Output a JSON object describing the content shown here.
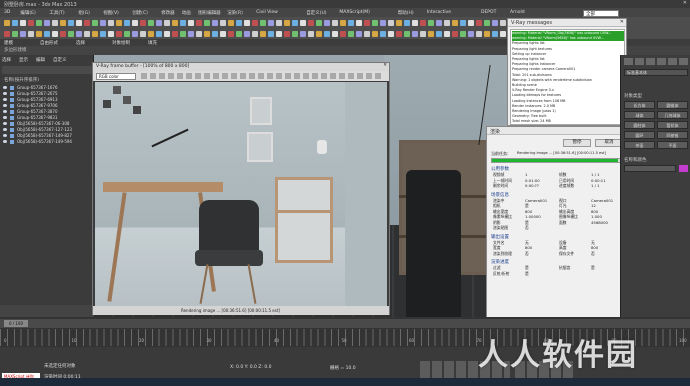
{
  "app": {
    "title": "别墅卧房.max - 3ds Max 2013"
  },
  "menu": [
    "3D",
    "编辑(E)",
    "工具(T)",
    "组(G)",
    "视图(V)",
    "创建(C)",
    "修改器",
    "动画",
    "图形编辑器",
    "渲染(R)",
    "Civil View",
    "自定义(U)",
    "MAXScript(M)",
    "帮助(H)",
    "Interactive",
    "DEPOT",
    "Arnold"
  ],
  "toolbar": {
    "selection_filter": "全部",
    "view_dropdown": "视图",
    "selection_set": "创建选择集"
  },
  "ribbon": {
    "tabs": [
      "建模",
      "自由形式",
      "选择",
      "对象绘制",
      "填充"
    ],
    "subtitle": "多边形建模"
  },
  "scene_explorer": {
    "tabs": [
      "选择",
      "显示",
      "编辑",
      "自定义"
    ],
    "header": "名称(按升序排序)",
    "items": [
      "Group-657367-1676",
      "Group-657367-2675",
      "Group-657367-6913",
      "Group-657367-9706",
      "Group-657367-3870",
      "Group-657367-9831",
      "Obj(5658)-657367-06-308",
      "Obj(5658)-657367-127-123",
      "Obj(5658)-657367-149-827",
      "Obj(5658)-657367-149-594"
    ]
  },
  "vfb": {
    "title": "V-Ray frame buffer - [100% of 800 x 800]",
    "channel": "RGB color",
    "status": "Rendering image ... [00:36:51.6] [00:00:11.5 est]"
  },
  "vray_messages": {
    "title": "V-Ray messages",
    "lines": [
      "warning: Material \"VNorm_Obj(5658)\" has unbound UVW...",
      "warning: Material \"VNorm(5658)\" has unbound UVW...",
      "Preparing lights list",
      "Preparing light textures",
      "Setting up instancer",
      "Preparing lights list",
      "Preparing lights instancer",
      "Preparing render camera Camera001",
      "Total: 201 sub-divisions",
      "Warning: 1 objects with rendertime subdivision",
      "Building scene",
      "V-Ray Render Engine 3.x",
      "Loading bitmaps for textures",
      "Loading instances from 108 MB",
      "Render instances: 2.0 MB",
      "Rendering image (pass 1)",
      "Geometry: Tree built",
      "Total mesh size: 24 MB"
    ]
  },
  "render_progress": {
    "title": "渲染",
    "btn_pause": "暂停",
    "btn_cancel": "取消",
    "current_task_label": "当前任务:",
    "current_task": "Rendering image ... [00:36:51.6] [00:00:11.5 est]",
    "progress": 0.97,
    "group_params": "公用参数",
    "p": [
      [
        "视频帧",
        "1"
      ],
      [
        "帧数",
        "1 / 1"
      ],
      [
        "上一帧时间",
        "0:01:00"
      ],
      [
        "已用时间",
        "0:00:11"
      ],
      [
        "剩余时间",
        "0:00:??"
      ],
      [
        "进度帧数",
        "1 / 1"
      ]
    ],
    "group_scene": "场景信息",
    "s": [
      [
        "渲染中",
        "Camera001"
      ],
      [
        "视口",
        "Camera001"
      ],
      [
        "相机",
        "是"
      ],
      [
        "灯光",
        "12"
      ],
      [
        "输出宽度",
        "800"
      ],
      [
        "输出高度",
        "800"
      ],
      [
        "像素纵横比",
        "1.00000"
      ],
      [
        "图像纵横比",
        "1.000"
      ],
      [
        "阴影",
        "是"
      ],
      [
        "面数",
        "4568000"
      ],
      [
        "渲染贴图",
        "否"
      ]
    ],
    "group_output": "输出设置",
    "o": [
      [
        "文件名",
        "无"
      ],
      [
        "设备",
        "无"
      ],
      [
        "宽度",
        "800"
      ],
      [
        "高度",
        "800"
      ],
      [
        "渲染到纹理",
        "否"
      ],
      [
        "保存文件",
        "否"
      ]
    ],
    "group_render": "渲染进度",
    "r": [
      [
        "过滤",
        "是"
      ],
      [
        "抗锯齿",
        "是"
      ],
      [
        "反射/折射",
        "是"
      ]
    ]
  },
  "command_panel": {
    "title": "对象类型",
    "tab": "标准基本体",
    "buttons": [
      "长方体",
      "圆锥体",
      "球体",
      "几何球体",
      "圆柱体",
      "管状体",
      "圆环",
      "四棱锥",
      "茶壶",
      "平面"
    ],
    "section": "名称和颜色"
  },
  "bottom": {
    "frame": "0 / 100",
    "status1": "未选定任何对象",
    "status2": "渲染时间 0:00:11",
    "mxs": "MAXScript 迷你",
    "tick_labels": [
      "0",
      "10",
      "20",
      "30",
      "40",
      "50",
      "60",
      "70",
      "80",
      "90",
      "100"
    ],
    "coords": "X: 0.0  Y: 0.0  Z: 0.0",
    "grid": "栅格 = 10.0"
  },
  "watermark": "人人软件园"
}
